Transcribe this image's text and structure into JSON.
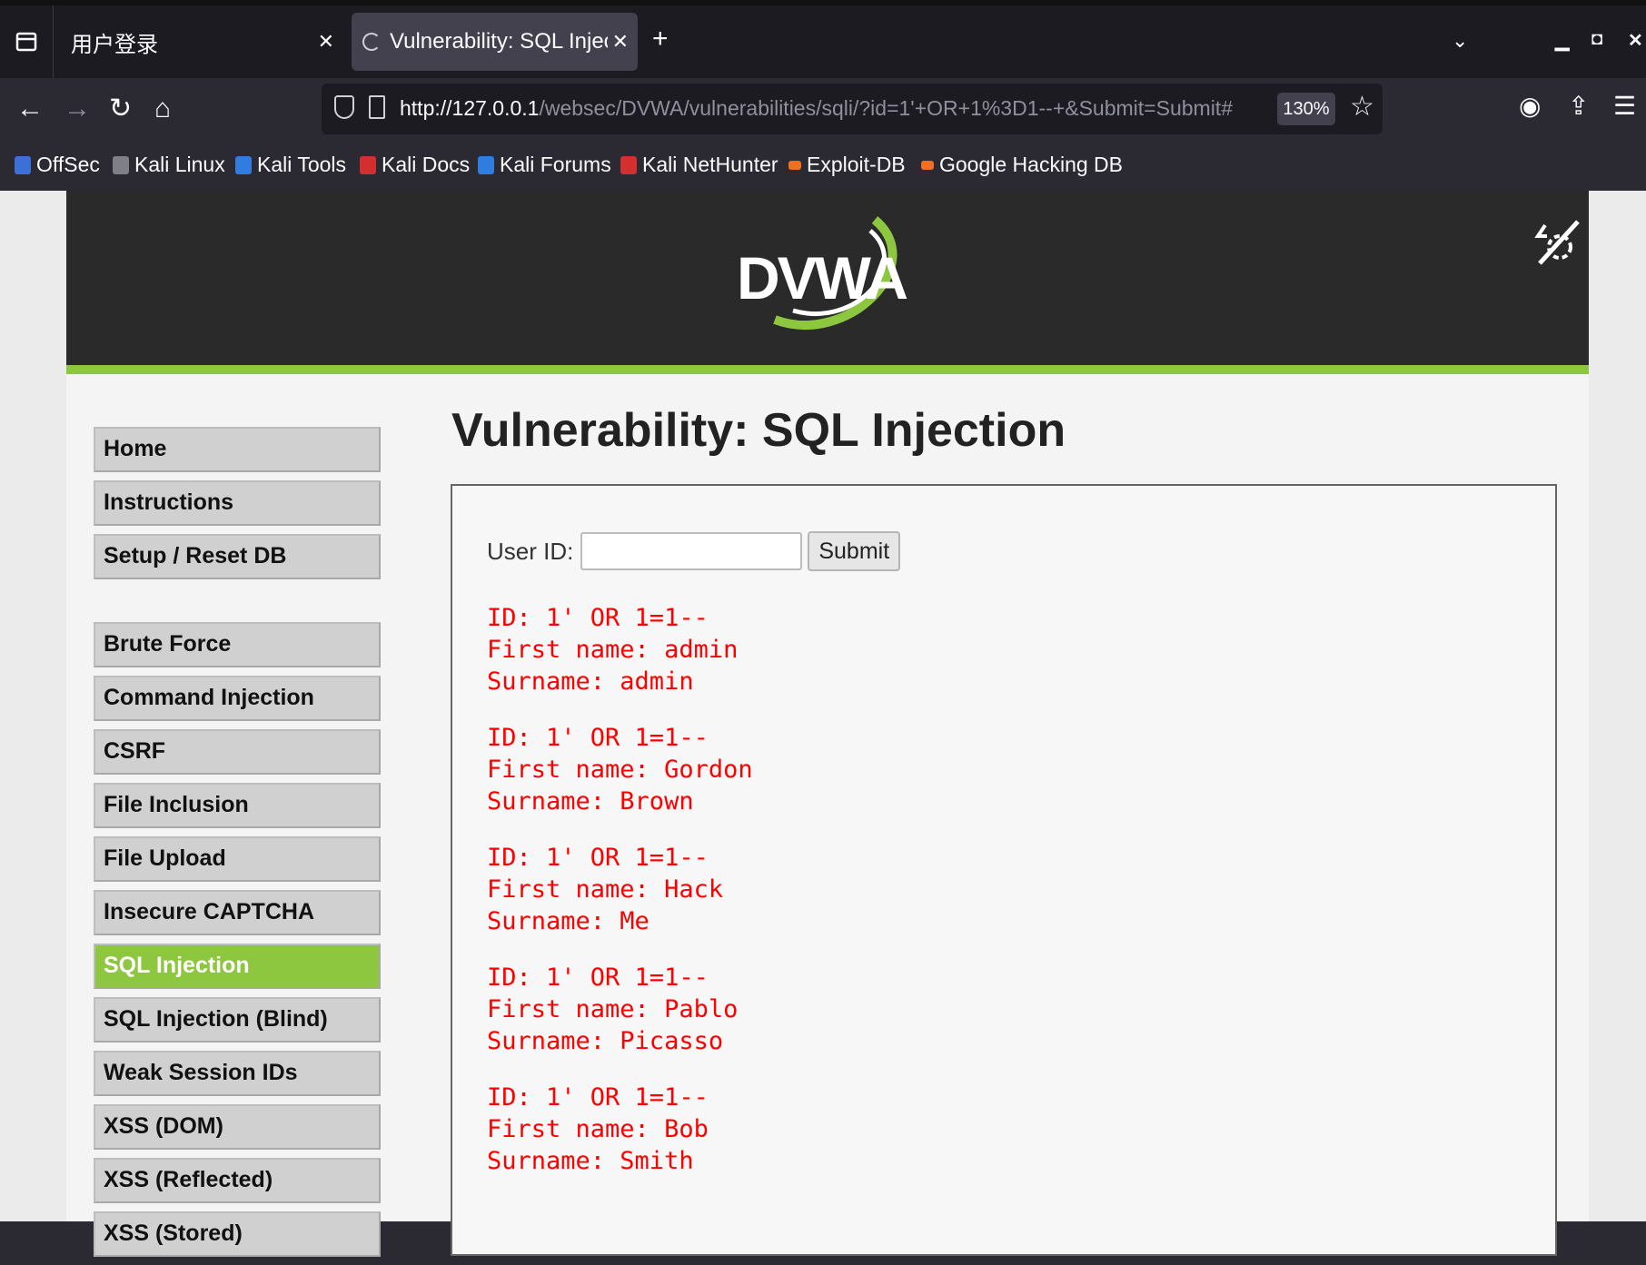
{
  "browser": {
    "tabs": [
      {
        "label": "用户登录",
        "active": false
      },
      {
        "label": "Vulnerability: SQL Injectio",
        "active": true
      }
    ],
    "url_host": "http://127.0.0.1",
    "url_path": "/websec/DVWA/vulnerabilities/sqli/?id=1'+OR+1%3D1--+&Submit=Submit#",
    "zoom": "130%",
    "bookmarks": [
      {
        "label": "OffSec",
        "color": "#3d6fd8"
      },
      {
        "label": "Kali Linux",
        "color": "#7f7f88"
      },
      {
        "label": "Kali Tools",
        "color": "#2f7de1"
      },
      {
        "label": "Kali Docs",
        "color": "#d32f2f"
      },
      {
        "label": "Kali Forums",
        "color": "#2f7de1"
      },
      {
        "label": "Kali NetHunter",
        "color": "#d32f2f"
      },
      {
        "label": "Exploit-DB",
        "color": "#f07020"
      },
      {
        "label": "Google Hacking DB",
        "color": "#f07020"
      }
    ]
  },
  "dvwa": {
    "logo": "DVWA",
    "accent": "#8dc63f",
    "menu_top": [
      "Home",
      "Instructions",
      "Setup / Reset DB"
    ],
    "menu_vulns": [
      "Brute Force",
      "Command Injection",
      "CSRF",
      "File Inclusion",
      "File Upload",
      "Insecure CAPTCHA",
      "SQL Injection",
      "SQL Injection (Blind)",
      "Weak Session IDs",
      "XSS (DOM)",
      "XSS (Reflected)",
      "XSS (Stored)"
    ],
    "active_menu": "SQL Injection",
    "page_title": "Vulnerability: SQL Injection",
    "form": {
      "label": "User ID:",
      "value": "",
      "submit": "Submit"
    },
    "results": [
      {
        "id": "ID: 1' OR 1=1--",
        "first": "First name: admin",
        "surname": "Surname: admin"
      },
      {
        "id": "ID: 1' OR 1=1--",
        "first": "First name: Gordon",
        "surname": "Surname: Brown"
      },
      {
        "id": "ID: 1' OR 1=1--",
        "first": "First name: Hack",
        "surname": "Surname: Me"
      },
      {
        "id": "ID: 1' OR 1=1--",
        "first": "First name: Pablo",
        "surname": "Surname: Picasso"
      },
      {
        "id": "ID: 1' OR 1=1--",
        "first": "First name: Bob",
        "surname": "Surname: Smith"
      }
    ]
  }
}
